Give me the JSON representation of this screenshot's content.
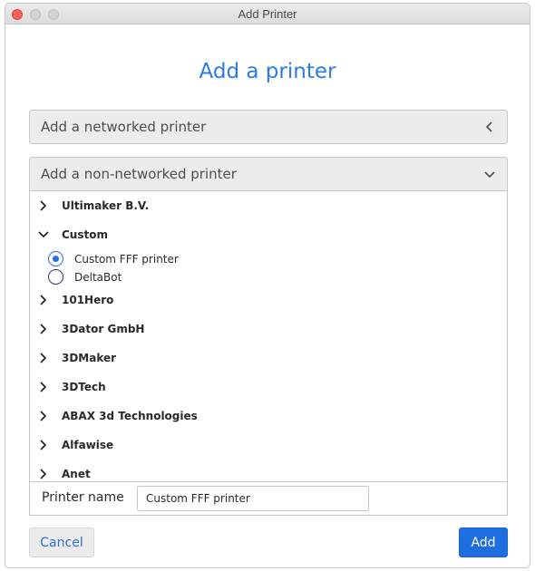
{
  "window": {
    "title": "Add Printer"
  },
  "heading": "Add a printer",
  "networked": {
    "label": "Add a networked printer",
    "icon": "chevron-left-icon"
  },
  "non_networked": {
    "label": "Add a non-networked printer",
    "icon": "chevron-down-icon"
  },
  "groups": [
    {
      "label": "Ultimaker B.V.",
      "expanded": false
    },
    {
      "label": "Custom",
      "expanded": true
    },
    {
      "label": "101Hero",
      "expanded": false
    },
    {
      "label": "3Dator GmbH",
      "expanded": false
    },
    {
      "label": "3DMaker",
      "expanded": false
    },
    {
      "label": "3DTech",
      "expanded": false
    },
    {
      "label": "ABAX 3d Technologies",
      "expanded": false
    },
    {
      "label": "Alfawise",
      "expanded": false
    },
    {
      "label": "Anet",
      "expanded": false
    }
  ],
  "custom_options": [
    {
      "label": "Custom FFF printer",
      "selected": true
    },
    {
      "label": "DeltaBot",
      "selected": false
    }
  ],
  "printer_name": {
    "label": "Printer name",
    "value": "Custom FFF printer"
  },
  "buttons": {
    "cancel": "Cancel",
    "add": "Add"
  },
  "colors": {
    "accent": "#2b7be0",
    "primary_button": "#1e6ee0",
    "close": "#fe5f57"
  }
}
